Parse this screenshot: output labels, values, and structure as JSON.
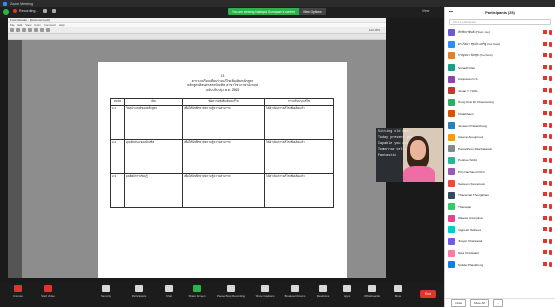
{
  "window": {
    "title": "Zoom Meeting"
  },
  "topbar": {
    "recording_label": "Recording...",
    "banner_message": "You are viewing Nattapol Sorraparn's screen",
    "banner_options": "View Options",
    "view_label": "View"
  },
  "doc_app": {
    "title": "Foxit Reader - [document.pdf]",
    "menu": [
      "File",
      "Edit",
      "View",
      "Form",
      "Comment",
      "Help"
    ],
    "zoom": "122.16%"
  },
  "document": {
    "header_lines": [
      "ตารางเปรียบเทียบร่างแก้ไขเพิ่มเติมหลักสูตร",
      "หลักสูตรศิลปศาสตรบัณฑิต สาขาวิชาภาษาอังกฤษ",
      "ฉบับปรับปรุง พ.ศ. 2565"
    ],
    "page_number": "13",
    "table": {
      "headers": [
        "หมวด",
        "เดิม",
        "ข้อความที่เพิ่มเติม/แก้ไข",
        "การปรับปรุงแก้ไข"
      ],
      "rows": [
        [
          "2.1",
          "วัตถุประสงค์ของหลักสูตร",
          "เพื่อให้นักศึกษามีความรู้ความสามารถ",
          "ได้ดำเนินการแก้ไขเพิ่มเติมแล้ว"
        ],
        [
          "2.2",
          "คุณลักษณะของบัณฑิต",
          "เพื่อให้นักศึกษามีความรู้ความสามารถ",
          "ได้ดำเนินการแก้ไขเพิ่มเติมแล้ว"
        ],
        [
          "2.3",
          "ผลลัพธ์การเรียนรู้",
          "เพื่อให้นักศึกษามีความรู้ความสามารถ",
          "ได้ดำเนินการแก้ไขเพิ่มเติมแล้ว"
        ]
      ]
    }
  },
  "speaker": {
    "board_lines": [
      "Sitting old man",
      "Today present you",
      "Capable you are",
      "Tomorrow tells",
      "Fantastic"
    ],
    "name": "Nattapol Sorraparn"
  },
  "toolbar": {
    "items": [
      {
        "label": "Unmute",
        "icon": "microphone-icon"
      },
      {
        "label": "Start Video",
        "icon": "video-camera-icon"
      },
      {
        "label": "Security",
        "icon": "shield-icon"
      },
      {
        "label": "Participants",
        "icon": "people-icon",
        "count": "25"
      },
      {
        "label": "Chat",
        "icon": "chat-icon"
      },
      {
        "label": "Share Screen",
        "icon": "share-screen-icon"
      },
      {
        "label": "Pause/Stop Recording",
        "icon": "record-icon"
      },
      {
        "label": "Show Captions",
        "icon": "captions-icon"
      },
      {
        "label": "Breakout Rooms",
        "icon": "breakout-icon"
      },
      {
        "label": "Reactions",
        "icon": "smile-icon"
      },
      {
        "label": "Apps",
        "icon": "apps-icon"
      },
      {
        "label": "Whiteboards",
        "icon": "whiteboard-icon"
      },
      {
        "label": "More",
        "icon": "more-icon"
      }
    ],
    "end_label": "End"
  },
  "participants": {
    "title": "Participants (25)",
    "search_placeholder": "Find a participant",
    "list": [
      {
        "name": "ทักษิณาพันธ์ (Host, me)",
        "color": "#6a5acd"
      },
      {
        "name": "ดร.กัลยา สุขประเสริฐ (Co-host)",
        "color": "#2d8cff"
      },
      {
        "name": "กาญจนา นิลสุข (Co-host)",
        "color": "#e67e22"
      },
      {
        "name": "Sunadh Rao",
        "color": "#16a085"
      },
      {
        "name": "Kanpassorn S.",
        "color": "#8e44ad"
      },
      {
        "name": "Jesan Y. Hoffe",
        "color": "#c0392b"
      },
      {
        "name": "Hung Prat Dr Channarong",
        "color": "#27ae60"
      },
      {
        "name": "Chakkhaon",
        "color": "#d35400"
      },
      {
        "name": "Jessam Prakanthong",
        "color": "#2980b9"
      },
      {
        "name": "Aleena Anoopnoot",
        "color": "#f39c12"
      },
      {
        "name": "Pamaithorn Ratchatasuk",
        "color": "#7f8c8d"
      },
      {
        "name": "Poobue Sridip",
        "color": "#1abc9c"
      },
      {
        "name": "Prin Nachanut KKC",
        "color": "#9b59b6"
      },
      {
        "name": "Sameen Ssonotoon",
        "color": "#e74c3c"
      },
      {
        "name": "Thanarnat Thongkham",
        "color": "#34495e"
      },
      {
        "name": "Thanapat",
        "color": "#2ecc71"
      },
      {
        "name": "Waewe Anunpinai",
        "color": "#e84393"
      },
      {
        "name": "Vignesh Sathees",
        "color": "#00cec9"
      },
      {
        "name": "Jirayut Chantarak",
        "color": "#6c5ce7"
      },
      {
        "name": "Nisa Chatsakul",
        "color": "#fd79a8"
      },
      {
        "name": "Sutida Phankhong",
        "color": "#0984e3"
      }
    ],
    "footer": {
      "invite": "Invite",
      "mute_all": "Mute All",
      "more": "..."
    }
  }
}
